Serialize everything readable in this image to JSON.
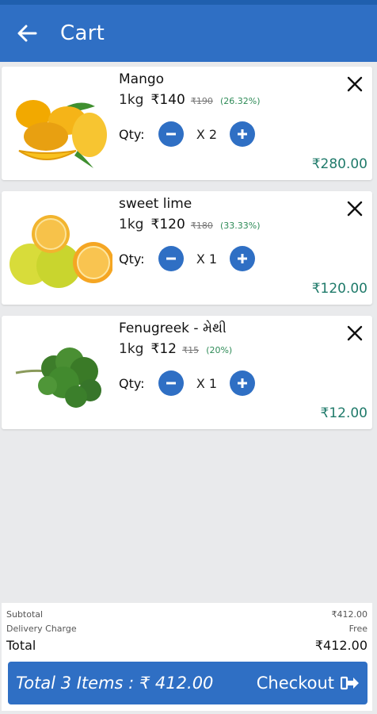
{
  "header": {
    "title": "Cart"
  },
  "items": [
    {
      "name": "Mango",
      "weight": "1kg",
      "price": "₹140",
      "mrp": "₹190",
      "discount": "(26.32%)",
      "qty_label": "Qty:",
      "qty": "X 2",
      "total": "₹280.00"
    },
    {
      "name": "sweet lime",
      "weight": "1kg",
      "price": "₹120",
      "mrp": "₹180",
      "discount": "(33.33%)",
      "qty_label": "Qty:",
      "qty": "X 1",
      "total": "₹120.00"
    },
    {
      "name": "Fenugreek - મેથી",
      "weight": "1kg",
      "price": "₹12",
      "mrp": "₹15",
      "discount": "(20%)",
      "qty_label": "Qty:",
      "qty": "X 1",
      "total": "₹12.00"
    }
  ],
  "summary": {
    "subtotal_label": "Subtotal",
    "subtotal_value": "₹412.00",
    "delivery_label": "Delivery Charge",
    "delivery_value": "Free",
    "total_label": "Total",
    "total_value": "₹412.00"
  },
  "checkout": {
    "total_text": "Total 3 Items : ₹ 412.00",
    "button_label": "Checkout"
  },
  "colors": {
    "primary": "#2f6fc4",
    "accent_green": "#1f7a6a",
    "discount_green": "#2e8b57"
  }
}
